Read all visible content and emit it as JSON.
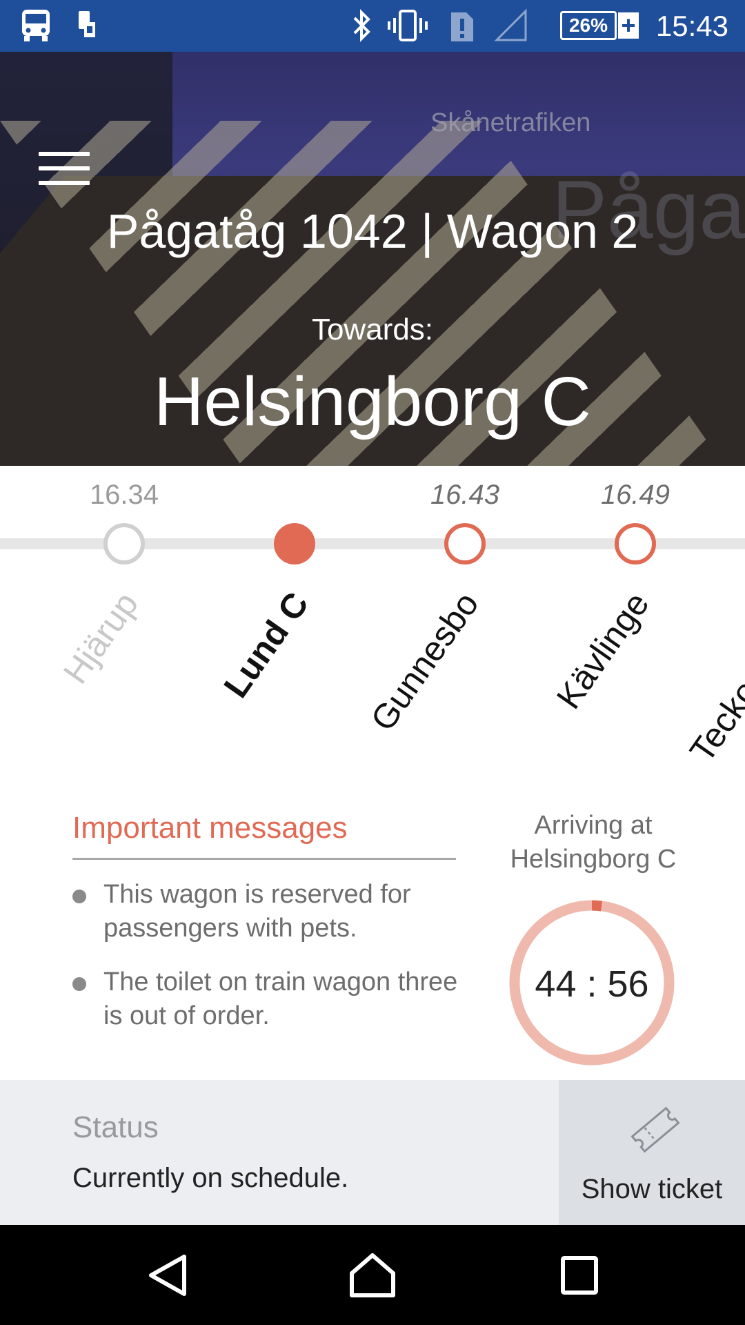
{
  "status_bar": {
    "time": "15:43",
    "battery_text": "26%",
    "battery_level": 0.26,
    "icons": [
      "bus-icon",
      "phone-sim-icon",
      "bluetooth-icon",
      "vibrate-icon",
      "alert-sim-icon",
      "signal-icon",
      "battery-icon",
      "charging-plus-icon"
    ]
  },
  "hero": {
    "title": "Pågatåg 1042 | Wagon 2",
    "towards_label": "Towards:",
    "destination": "Helsingborg C",
    "photo_brand_text": "Skånetrafiken",
    "photo_train_text": "Pågatåg"
  },
  "route": {
    "stops": [
      {
        "name": "Hjärup",
        "time": "16.34",
        "state": "passed"
      },
      {
        "name": "Lund C",
        "time": "",
        "state": "current"
      },
      {
        "name": "Gunnesbo",
        "time": "16.43",
        "state": "upcoming"
      },
      {
        "name": "Kävlinge",
        "time": "16.49",
        "state": "upcoming"
      },
      {
        "name": "Teckomatorp",
        "time": "",
        "state": "upcoming"
      }
    ],
    "colors": {
      "passed": "#d0d0d0",
      "current": "#e06a54",
      "upcoming": "#e06a54",
      "line": "#e6e6e6"
    }
  },
  "messages": {
    "title": "Important messages",
    "items": [
      "This wagon is reserved for passengers with pets.",
      "The toilet on train wagon three is out of order."
    ]
  },
  "arrival": {
    "label": "Arriving at Helsingborg C",
    "countdown": "44 : 56",
    "progress": 0.02,
    "ring_color": "#f0b9ad",
    "progress_color": "#e06a54"
  },
  "status": {
    "label": "Status",
    "text": "Currently on schedule."
  },
  "ticket": {
    "label": "Show ticket"
  },
  "nav_bar": {
    "buttons": [
      "back-icon",
      "home-icon",
      "recents-icon"
    ]
  }
}
